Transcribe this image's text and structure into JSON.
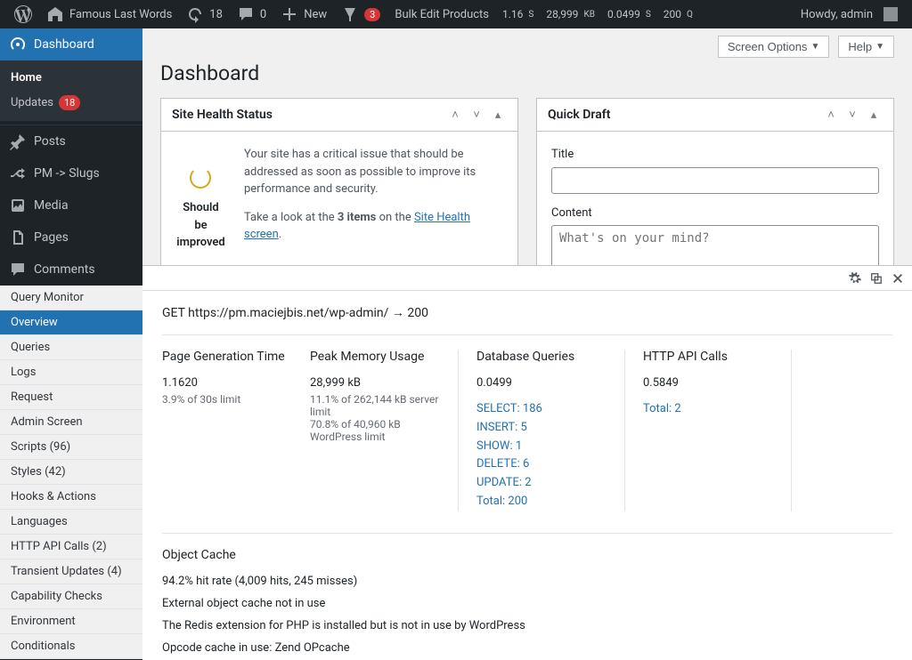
{
  "adminbar": {
    "site_name": "Famous Last Words",
    "updates_count": "18",
    "comments_count": "0",
    "new_label": "New",
    "yoast_count": "3",
    "bulk_edit": "Bulk Edit Products",
    "stats": {
      "time": "1.16",
      "time_unit": "S",
      "mem": "28,999",
      "mem_unit": "KB",
      "db": "0.0499",
      "db_unit": "S",
      "q": "200",
      "q_unit": "Q"
    },
    "howdy": "Howdy, admin"
  },
  "menu": {
    "dashboard": "Dashboard",
    "home": "Home",
    "updates": "Updates",
    "updates_count": "18",
    "posts": "Posts",
    "pm_slugs": "PM -> Slugs",
    "media": "Media",
    "pages": "Pages",
    "comments": "Comments"
  },
  "qm_menu": {
    "header": "Query Monitor",
    "overview": "Overview",
    "queries": "Queries",
    "logs": "Logs",
    "request": "Request",
    "admin_screen": "Admin Screen",
    "scripts": "Scripts (96)",
    "styles": "Styles (42)",
    "hooks": "Hooks & Actions",
    "languages": "Languages",
    "http_api": "HTTP API Calls (2)",
    "transients": "Transient Updates (4)",
    "capability": "Capability Checks",
    "environment": "Environment",
    "conditionals": "Conditionals"
  },
  "top": {
    "screen_options": "Screen Options",
    "help": "Help"
  },
  "page_title": "Dashboard",
  "site_health": {
    "title": "Site Health Status",
    "label": "Should be improved",
    "text1": "Your site has a critical issue that should be addressed as soon as possible to improve its performance and security.",
    "text2a": "Take a look at the ",
    "text2b": "3 items",
    "text2c": " on the ",
    "link": "Site Health screen",
    "text2d": "."
  },
  "quick_draft": {
    "title": "Quick Draft",
    "title_label": "Title",
    "content_label": "Content",
    "content_placeholder": "What's on your mind?"
  },
  "qm_panel": {
    "url_line": "GET https://pm.maciejbis.net/wp-admin/ → 200",
    "cols": {
      "gen_h": "Page Generation Time",
      "gen_v": "1.1620",
      "gen_s": "3.9% of 30s limit",
      "mem_h": "Peak Memory Usage",
      "mem_v": "28,999 kB",
      "mem_s1": "11.1% of 262,144 kB server limit",
      "mem_s2": "70.8% of 40,960 kB WordPress limit",
      "db_h": "Database Queries",
      "db_v": "0.0499",
      "db_links": [
        "SELECT: 186",
        "INSERT: 5",
        "SHOW: 1",
        "DELETE: 6",
        "UPDATE: 2",
        "Total: 200"
      ],
      "http_h": "HTTP API Calls",
      "http_v": "0.5849",
      "http_links": [
        "Total: 2"
      ]
    },
    "cache_h": "Object Cache",
    "cache_lines": [
      "94.2% hit rate (4,009 hits, 245 misses)",
      "External object cache not in use",
      "The Redis extension for PHP is installed but is not in use by WordPress",
      "Opcode cache in use: Zend OPcache"
    ]
  }
}
